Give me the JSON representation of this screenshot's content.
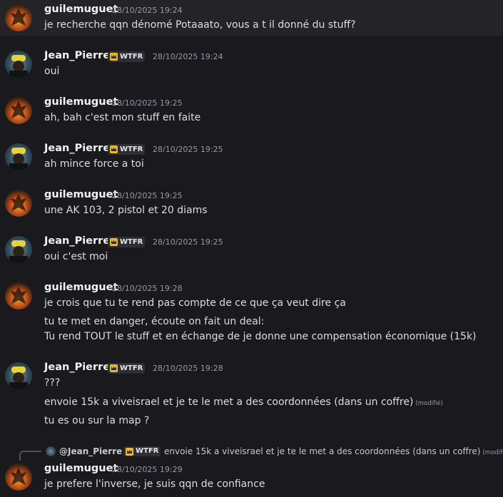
{
  "messages": [
    {
      "author": "guilemuguet",
      "timestamp": "28/10/2025 19:24",
      "lines": [
        "je recherche qqn dénomé Potaaato, vous a t il donné du stuff?"
      ]
    },
    {
      "author": "Jean_Pierre",
      "badge": "WTFR",
      "timestamp": "28/10/2025 19:24",
      "lines": [
        "oui"
      ]
    },
    {
      "author": "guilemuguet",
      "timestamp": "28/10/2025 19:25",
      "lines": [
        "ah, bah c'est mon stuff en faite"
      ]
    },
    {
      "author": "Jean_Pierre",
      "badge": "WTFR",
      "timestamp": "28/10/2025 19:25",
      "lines": [
        "ah mince force a toi"
      ]
    },
    {
      "author": "guilemuguet",
      "timestamp": "28/10/2025 19:25",
      "lines": [
        "une AK 103, 2 pistol et 20 diams"
      ]
    },
    {
      "author": "Jean_Pierre",
      "badge": "WTFR",
      "timestamp": "28/10/2025 19:25",
      "lines": [
        "oui c'est moi"
      ]
    },
    {
      "author": "guilemuguet",
      "timestamp": "28/10/2025 19:28",
      "lines": [
        "je crois que tu te rend pas compte de ce que ça veut dire ça",
        "tu te met en danger, écoute on fait un deal:",
        "Tu rend TOUT le stuff et en échange de je donne une compensation économique (15k)"
      ]
    },
    {
      "author": "Jean_Pierre",
      "badge": "WTFR",
      "timestamp": "28/10/2025 19:28",
      "lines": [
        "???",
        "envoie 15k a viveisrael et je te le met a des coordonnées (dans un coffre)",
        "tu es ou sur la map ?"
      ],
      "edited": "(modifié)"
    },
    {
      "author": "guilemuguet",
      "timestamp": "28/10/2025 19:29",
      "lines": [
        "je prefere l'inverse, je suis qqn de confiance"
      ]
    }
  ],
  "reply": {
    "author": "@Jean_Pierre",
    "badge": "WTFR",
    "text": "envoie 15k a viveisrael et je te le met a des coordonnées (dans un coffre)",
    "edited": "(modifié)"
  },
  "colors": {
    "background": "#1a1a1e",
    "highlight": "#232328",
    "username": "#f2f3f5",
    "timestamp": "#949ba4",
    "badge_icon": "#e5b83a"
  },
  "icons": {
    "guilemuguet_avatar": "avatar-fire-figure",
    "jean_pierre_avatar": "avatar-yellow-cap-figure",
    "badge": "crown-icon"
  }
}
